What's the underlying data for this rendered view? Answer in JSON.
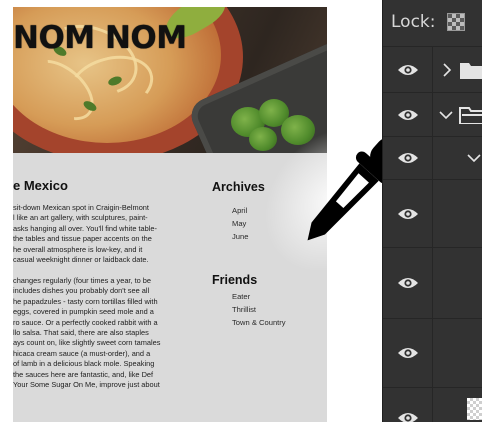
{
  "document": {
    "site_title": "NOM NOM",
    "section_title": "e Mexico",
    "paragraph_1": [
      "sit-down Mexican spot in Craigin-Belmont",
      "l like an art gallery, with sculptures, paint-",
      "asks hanging all over. You'll find white table-",
      "the tables and tissue paper accents on the",
      "he overall atmosphere is low-key, and it",
      "casual weeknight dinner or laidback date."
    ],
    "paragraph_2": [
      "changes regularly (four times a year, to be",
      "includes dishes you probably don't see all",
      "he papadzules - tasty corn tortillas filled with",
      "eggs, covered in pumpkin seed mole and a",
      "ro sauce. Or a perfectly cooked rabbit with a",
      "llo salsa. That said, there are also staples",
      "ays count on, like slightly sweet corn tamales",
      "hicaca cream sauce (a must-order), and a",
      "of lamb in a delicious black mole. Speaking",
      " the sauces here are fantastic, and, like Def",
      "Your Some Sugar On Me, improve just about"
    ],
    "archives": {
      "heading": "Archives",
      "items": [
        "April",
        "May",
        "June"
      ]
    },
    "friends": {
      "heading": "Friends",
      "items": [
        "Eater",
        "Thrillist",
        "Town & Country"
      ]
    }
  },
  "tool": {
    "cursor_icon": "eyedropper-icon"
  },
  "layers_panel": {
    "lock_label": "Lock:",
    "lock_icon": "transparency-lock-icon",
    "colors": {
      "panel_bg": "#323232",
      "divider": "#262626",
      "icon": "#e4e4e4"
    }
  }
}
